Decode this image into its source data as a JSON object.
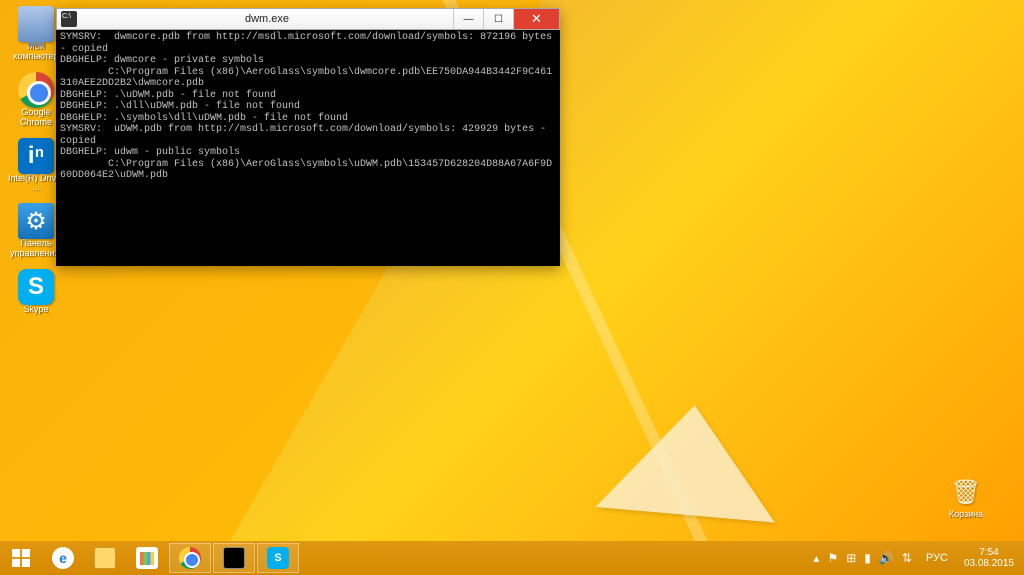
{
  "desktop_icons_left": [
    {
      "name": "computer-icon",
      "label": "Мой компьютер",
      "cls": "ico-computer",
      "glyph": ""
    },
    {
      "name": "chrome-icon",
      "label": "Google Chrome",
      "cls": "ico-chrome",
      "glyph": ""
    },
    {
      "name": "intel-icon",
      "label": "Intel(R) Driver ...",
      "cls": "ico-intel",
      "glyph": "iⁿ"
    },
    {
      "name": "control-panel-icon",
      "label": "Панель управлени...",
      "cls": "ico-cpanel",
      "glyph": "⚙"
    },
    {
      "name": "skype-icon",
      "label": "Skype",
      "cls": "ico-skype",
      "glyph": "S"
    }
  ],
  "desktop_icons_right": [
    {
      "name": "recycle-bin-icon",
      "label": "Корзина",
      "cls": "ico-recycle",
      "glyph": "🗑"
    }
  ],
  "window": {
    "title": "dwm.exe",
    "icon_name": "console-icon"
  },
  "console_lines": [
    "SYMSRV:  dwmcore.pdb from http://msdl.microsoft.com/download/symbols: 872196 bytes - copied",
    "DBGHELP: dwmcore - private symbols",
    "        C:\\Program Files (x86)\\AeroGlass\\symbols\\dwmcore.pdb\\EE750DA944B3442F9C461310AEE2DD2B2\\dwmcore.pdb",
    "DBGHELP: .\\uDWM.pdb - file not found",
    "DBGHELP: .\\dll\\uDWM.pdb - file not found",
    "DBGHELP: .\\symbols\\dll\\uDWM.pdb - file not found",
    "SYMSRV:  uDWM.pdb from http://msdl.microsoft.com/download/symbols: 429929 bytes - copied",
    "DBGHELP: udwm - public symbols",
    "        C:\\Program Files (x86)\\AeroGlass\\symbols\\uDWM.pdb\\153457D628204D88A67A6F9D60DD064E2\\uDWM.pdb"
  ],
  "taskbar": {
    "items": [
      {
        "name": "taskbar-ie",
        "cls": "tb-ie",
        "glyph": "e",
        "running": false
      },
      {
        "name": "taskbar-explorer",
        "cls": "tb-explorer",
        "glyph": "",
        "running": false
      },
      {
        "name": "taskbar-store",
        "cls": "tb-store",
        "glyph": "",
        "running": false
      },
      {
        "name": "taskbar-chrome",
        "cls": "tb-chrome",
        "glyph": "",
        "running": true
      },
      {
        "name": "taskbar-cmd",
        "cls": "tb-cmd",
        "glyph": "",
        "running": true
      },
      {
        "name": "taskbar-skype",
        "cls": "tb-skype",
        "glyph": "S",
        "running": true
      }
    ],
    "tray": [
      {
        "name": "tray-up-icon",
        "glyph": "▴"
      },
      {
        "name": "tray-flag-icon",
        "glyph": "⚑"
      },
      {
        "name": "tray-window-icon",
        "glyph": "⊞"
      },
      {
        "name": "tray-wifi-icon",
        "glyph": "▮"
      },
      {
        "name": "tray-volume-icon",
        "glyph": "🔊"
      },
      {
        "name": "tray-network-icon",
        "glyph": "⇅"
      }
    ],
    "lang": "РУС",
    "clock": {
      "time": "7:54",
      "date": "03.08.2015"
    }
  }
}
